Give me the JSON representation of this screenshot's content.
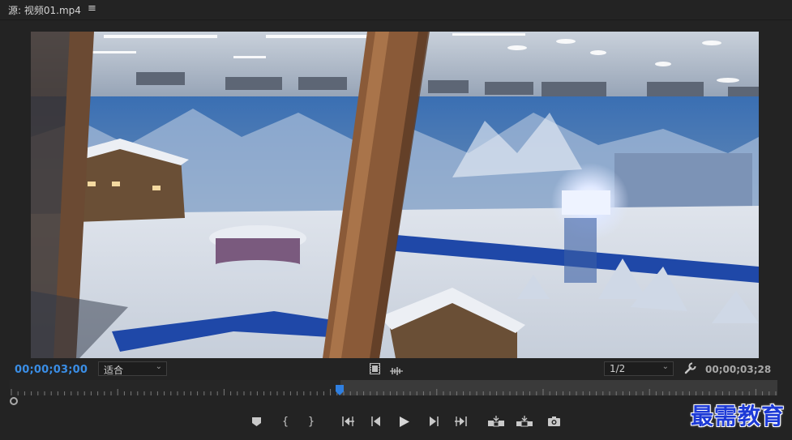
{
  "panel": {
    "title": "源: 视频01.mp4",
    "menu_icon": "hamburger-menu-icon"
  },
  "viewer": {
    "current_timecode": "00;00;03;00",
    "duration_timecode": "00;00;03;28",
    "zoom_value": "适合",
    "resolution_value": "1/2",
    "playhead_position": 0.415
  },
  "icons": {
    "drag_video": "film-frame-icon",
    "drag_audio": "audio-waveform-icon",
    "settings": "wrench-icon",
    "add_marker": "marker-icon",
    "mark_in": "mark-in-icon",
    "mark_out": "mark-out-icon",
    "go_to_in": "go-to-in-icon",
    "step_back": "step-back-icon",
    "play": "play-icon",
    "step_forward": "step-forward-icon",
    "go_to_out": "go-to-out-icon",
    "insert": "insert-icon",
    "overwrite": "overwrite-icon",
    "export_frame": "camera-icon"
  },
  "colors": {
    "accent": "#3a8ee6",
    "background": "#232323",
    "watermark": "#1d3ad6"
  },
  "watermark": {
    "text": "最需教育"
  }
}
